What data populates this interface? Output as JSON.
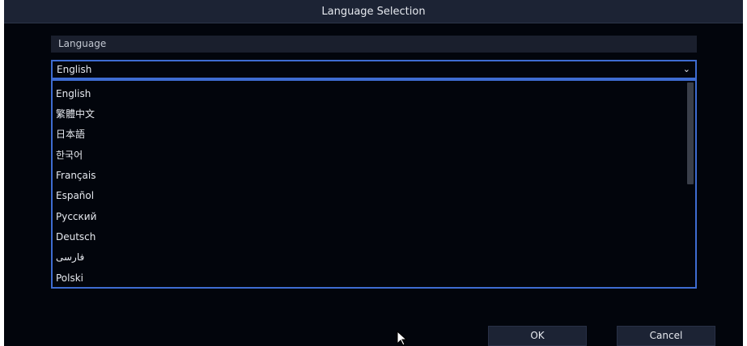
{
  "dialog": {
    "title": "Language Selection",
    "section_label": "Language",
    "selected_value": "English",
    "options": [
      "English",
      "繁體中文",
      "日本語",
      "한국어",
      "Français",
      "Español",
      "Русский",
      "Deutsch",
      "فارسی",
      "Polski"
    ],
    "ok_label": "OK",
    "cancel_label": "Cancel"
  },
  "colors": {
    "background": "#02050c",
    "titlebar": "#1c2334",
    "accent_border": "#3e6cd1",
    "text": "#e6e9ef"
  },
  "icons": {
    "dropdown_arrow": "chevron-down-icon",
    "pointer": "mouse-cursor-icon"
  }
}
